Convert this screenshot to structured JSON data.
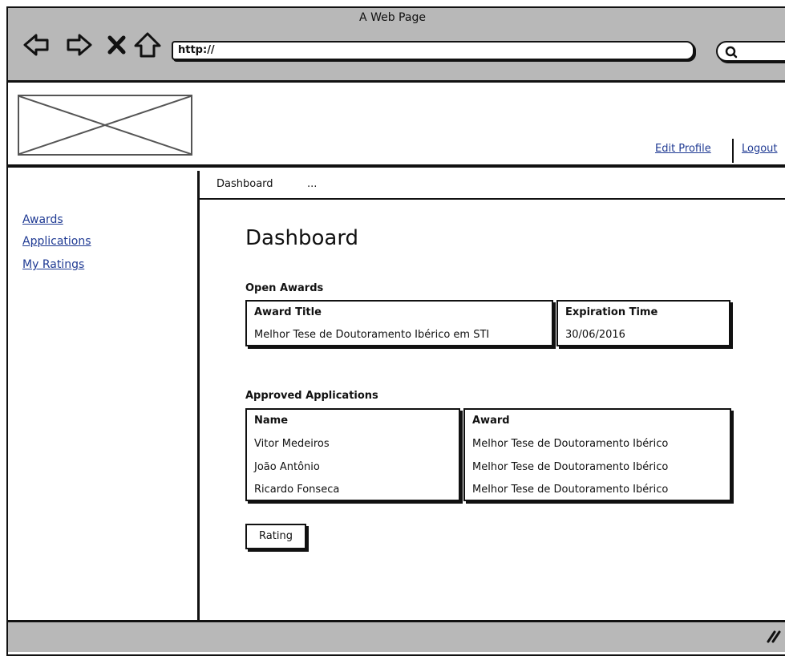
{
  "window": {
    "title": "A Web Page"
  },
  "browser": {
    "url": "http://",
    "icons": [
      "back-arrow-icon",
      "forward-arrow-icon",
      "close-x-icon",
      "home-icon",
      "search-icon"
    ]
  },
  "header": {
    "links": [
      {
        "label": "Edit Profile"
      },
      {
        "label": "Logout"
      }
    ]
  },
  "sidebar": {
    "items": [
      {
        "label": "Awards"
      },
      {
        "label": "Applications"
      },
      {
        "label": "My Ratings"
      }
    ]
  },
  "breadcrumb": {
    "current": "Dashboard",
    "more": "..."
  },
  "main": {
    "title": "Dashboard",
    "open_awards": {
      "label": "Open Awards",
      "columns": [
        "Award Title",
        "Expiration Time"
      ],
      "rows": [
        [
          "Melhor Tese de Doutoramento Ibérico em STI",
          "30/06/2016"
        ]
      ]
    },
    "approved_applications": {
      "label": "Approved Applications",
      "columns": [
        "Name",
        "Award"
      ],
      "rows": [
        [
          "Vitor Medeiros",
          "Melhor Tese de Doutoramento Ibérico"
        ],
        [
          "João Antônio",
          "Melhor Tese de Doutoramento Ibérico"
        ],
        [
          "Ricardo Fonseca",
          "Melhor Tese de Doutoramento Ibérico"
        ]
      ]
    },
    "rating_button": {
      "label": "Rating"
    }
  },
  "colors": {
    "chrome": "#b8b8b8",
    "link": "#1f3a93",
    "ink": "#111111"
  }
}
